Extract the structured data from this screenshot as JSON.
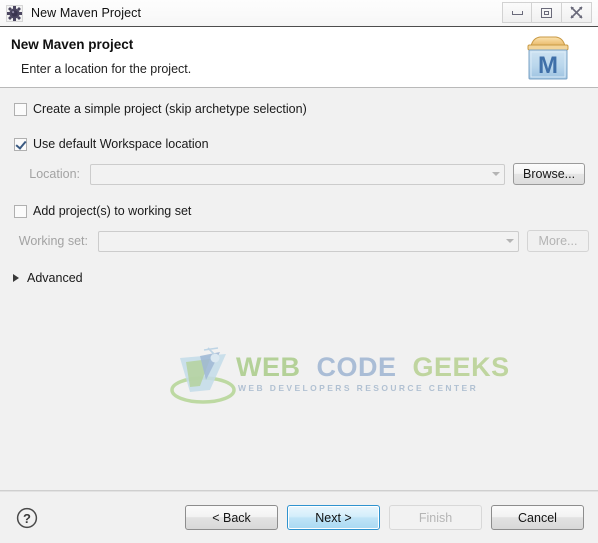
{
  "window": {
    "title": "New Maven Project",
    "icon": "eclipse-maven-icon",
    "controls": {
      "minimize": "minimize-button",
      "maximize": "maximize-button",
      "close": "close-button"
    }
  },
  "header": {
    "title": "New Maven project",
    "subtitle": "Enter a location for the project.",
    "icon": "maven-project-icon",
    "icon_letter": "M"
  },
  "form": {
    "simple_project": {
      "label": "Create a simple project (skip archetype selection)",
      "checked": false
    },
    "default_workspace": {
      "label": "Use default Workspace location",
      "checked": true
    },
    "location": {
      "label": "Location:",
      "value": "",
      "placeholder": "",
      "enabled": false,
      "browse_label": "Browse..."
    },
    "working_set_check": {
      "label": "Add project(s) to working set",
      "checked": false
    },
    "working_set": {
      "label": "Working set:",
      "value": "",
      "placeholder": "",
      "enabled": false,
      "more_label": "More..."
    },
    "advanced": {
      "label": "Advanced",
      "expanded": false
    }
  },
  "watermark": {
    "word1": "WEB",
    "word2": "CODE",
    "word3": "GEEKS",
    "tagline": "WEB DEVELOPERS RESOURCE CENTER"
  },
  "footer": {
    "help": "help-icon",
    "buttons": [
      {
        "label": "< Back",
        "state": "enabled"
      },
      {
        "label": "Next >",
        "state": "default"
      },
      {
        "label": "Finish",
        "state": "disabled"
      },
      {
        "label": "Cancel",
        "state": "enabled"
      }
    ]
  },
  "colors": {
    "accent": "#2f93cf",
    "header_bg": "#ffffff",
    "body_bg": "#f1f1f1",
    "maven_blue": "#3f6fa8",
    "watermark_green": "#8fbf63",
    "watermark_blue": "#7f9ec7"
  }
}
